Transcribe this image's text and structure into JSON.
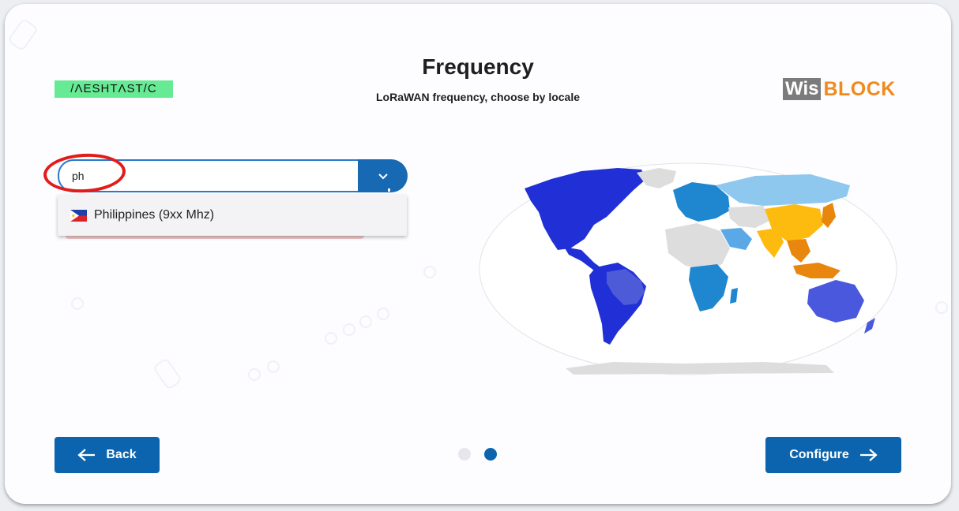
{
  "header": {
    "title": "Frequency",
    "subtitle": "LoRaWAN frequency, choose by locale",
    "logo_left_text": "/ΛESHTΛST/C",
    "logo_right_wis": "Wis",
    "logo_right_block": "BLOCK"
  },
  "frequency_select": {
    "input_value": "ph",
    "options": [
      {
        "label": "Philippines (9xx Mhz)",
        "flag": "philippines-flag-icon"
      }
    ]
  },
  "map": {
    "icon": "world-frequency-map",
    "colors": {
      "americas": "#2130d6",
      "south_america_alt": "#4d5bd9",
      "europe_africa": "#1f87d0",
      "russia": "#8ec8ef",
      "china": "#fdbb0f",
      "southeast_asia": "#e8860e",
      "australia": "#4a58de",
      "unassigned": "#dddddd"
    }
  },
  "pagination": {
    "total_steps": 2,
    "current_step": 2,
    "active_color": "#0b64ad",
    "inactive_color": "#e6e7ec"
  },
  "footer": {
    "back_label": "Back",
    "configure_label": "Configure"
  },
  "annotation": {
    "highlight_color": "#e21b1b"
  }
}
